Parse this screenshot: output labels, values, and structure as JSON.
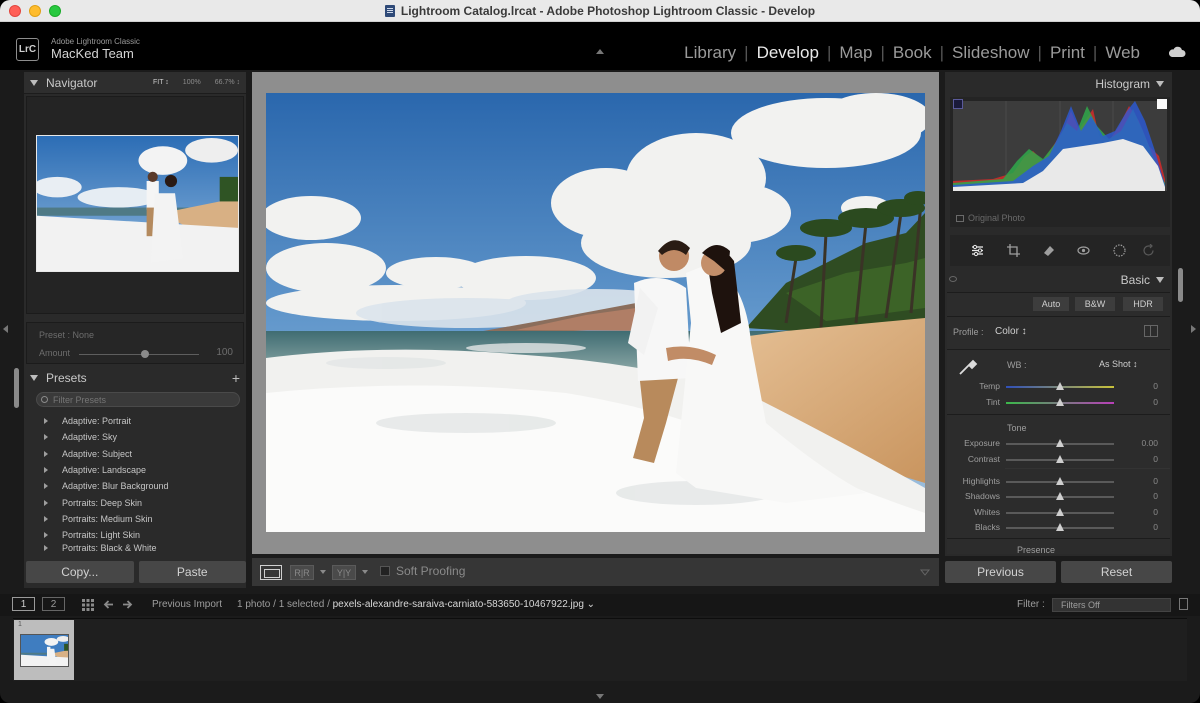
{
  "window": {
    "title": "Lightroom Catalog.lrcat - Adobe Photoshop Lightroom Classic - Develop"
  },
  "identity": {
    "badge": "LrC",
    "app_name": "Adobe Lightroom Classic",
    "team": "MacKed Team"
  },
  "modules": {
    "items": [
      "Library",
      "Develop",
      "Map",
      "Book",
      "Slideshow",
      "Print",
      "Web"
    ],
    "active": "Develop"
  },
  "navigator": {
    "title": "Navigator",
    "zoom_fit": "FIT ↕",
    "zoom_100": "100%",
    "zoom_custom": "66.7% ↕"
  },
  "preset_amount": {
    "preset_label": "Preset : None",
    "amount_label": "Amount",
    "amount_value": "100",
    "amount_fraction": 0.55
  },
  "presets": {
    "title": "Presets",
    "add_label": "+",
    "filter_placeholder": "Filter Presets",
    "items": [
      "Adaptive: Portrait",
      "Adaptive: Sky",
      "Adaptive: Subject",
      "Adaptive: Landscape",
      "Adaptive: Blur Background",
      "Portraits: Deep Skin",
      "Portraits: Medium Skin",
      "Portraits: Light Skin",
      "Portraits: Black & White"
    ]
  },
  "left_buttons": {
    "copy": "Copy...",
    "paste": "Paste"
  },
  "toolbar": {
    "ref_view": "R|R",
    "before_after": "Y|Y",
    "soft_proofing": "Soft Proofing"
  },
  "histogram": {
    "title": "Histogram",
    "original_photo": "Original Photo"
  },
  "basic": {
    "title": "Basic",
    "treatments": [
      "Auto",
      "B&W",
      "HDR"
    ],
    "profile_label": "Profile :",
    "profile_value": "Color ↕",
    "wb_label": "WB :",
    "wb_value": "As Shot ↕",
    "tone_label": "Tone",
    "presence_label": "Presence",
    "sliders": [
      {
        "name": "Temp",
        "value": "0",
        "fraction": 0.5
      },
      {
        "name": "Tint",
        "value": "0",
        "fraction": 0.5
      },
      {
        "name": "Exposure",
        "value": "0.00",
        "fraction": 0.5
      },
      {
        "name": "Contrast",
        "value": "0",
        "fraction": 0.5
      },
      {
        "name": "Highlights",
        "value": "0",
        "fraction": 0.5
      },
      {
        "name": "Shadows",
        "value": "0",
        "fraction": 0.5
      },
      {
        "name": "Whites",
        "value": "0",
        "fraction": 0.5
      },
      {
        "name": "Blacks",
        "value": "0",
        "fraction": 0.5
      }
    ]
  },
  "right_buttons": {
    "previous": "Previous",
    "reset": "Reset"
  },
  "filmstrip_bar": {
    "monitor1": "1",
    "monitor2": "2",
    "source": "Previous Import",
    "count": "1 photo / 1 selected /",
    "filename": "pexels-alexandre-saraiva-carniato-583650-10467922.jpg ⌄",
    "filter_label": "Filter :",
    "filter_value": "Filters Off"
  },
  "filmstrip": {
    "index": "1"
  },
  "colors": {
    "accent_active": "#e9e9e9",
    "panel_bg": "#2a2a2a",
    "center_bg": "#8e8e8e",
    "button_bg": "#474747"
  }
}
